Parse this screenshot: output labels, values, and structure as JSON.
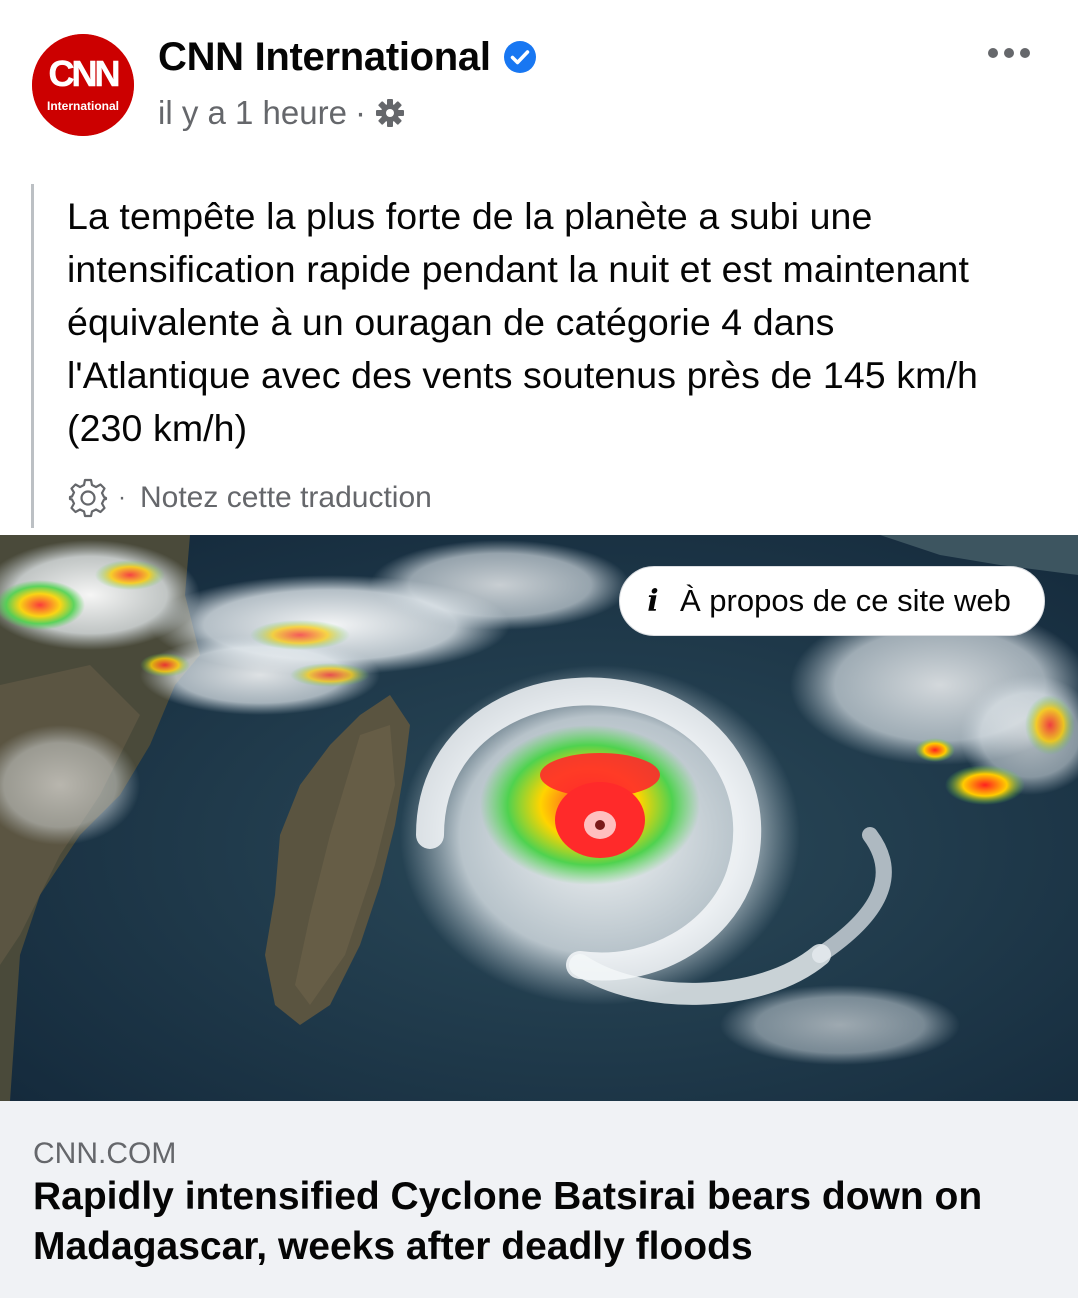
{
  "post": {
    "author": "CNN International",
    "avatar_text": "CNN",
    "avatar_subtext": "International",
    "time": "il y a 1 heure",
    "separator": "·",
    "text": "La tempête la plus forte de la planète a subi une intensification rapide pendant la nuit et est maintenant équivalente à un ouragan de catégorie 4 dans l'Atlantique avec des vents soutenus près de 145 km/h (230 km/h)",
    "rate_separator": "·",
    "rate_translation": "Notez cette traduction"
  },
  "image": {
    "about_label": "À propos de ce site web",
    "about_icon": "i"
  },
  "link": {
    "domain": "CNN.COM",
    "title": "Rapidly intensified Cyclone Batsirai bears down on Madagascar, weeks after deadly floods"
  },
  "icons": {
    "verified": "verified-badge-icon",
    "audience": "gear-icon",
    "more": "more-options-icon",
    "translate_settings": "gear-icon",
    "info": "info-icon"
  },
  "colors": {
    "brand_red": "#cc0000",
    "verified_blue": "#1877f2",
    "secondary_text": "#65676b",
    "link_bg": "#f0f2f5"
  }
}
